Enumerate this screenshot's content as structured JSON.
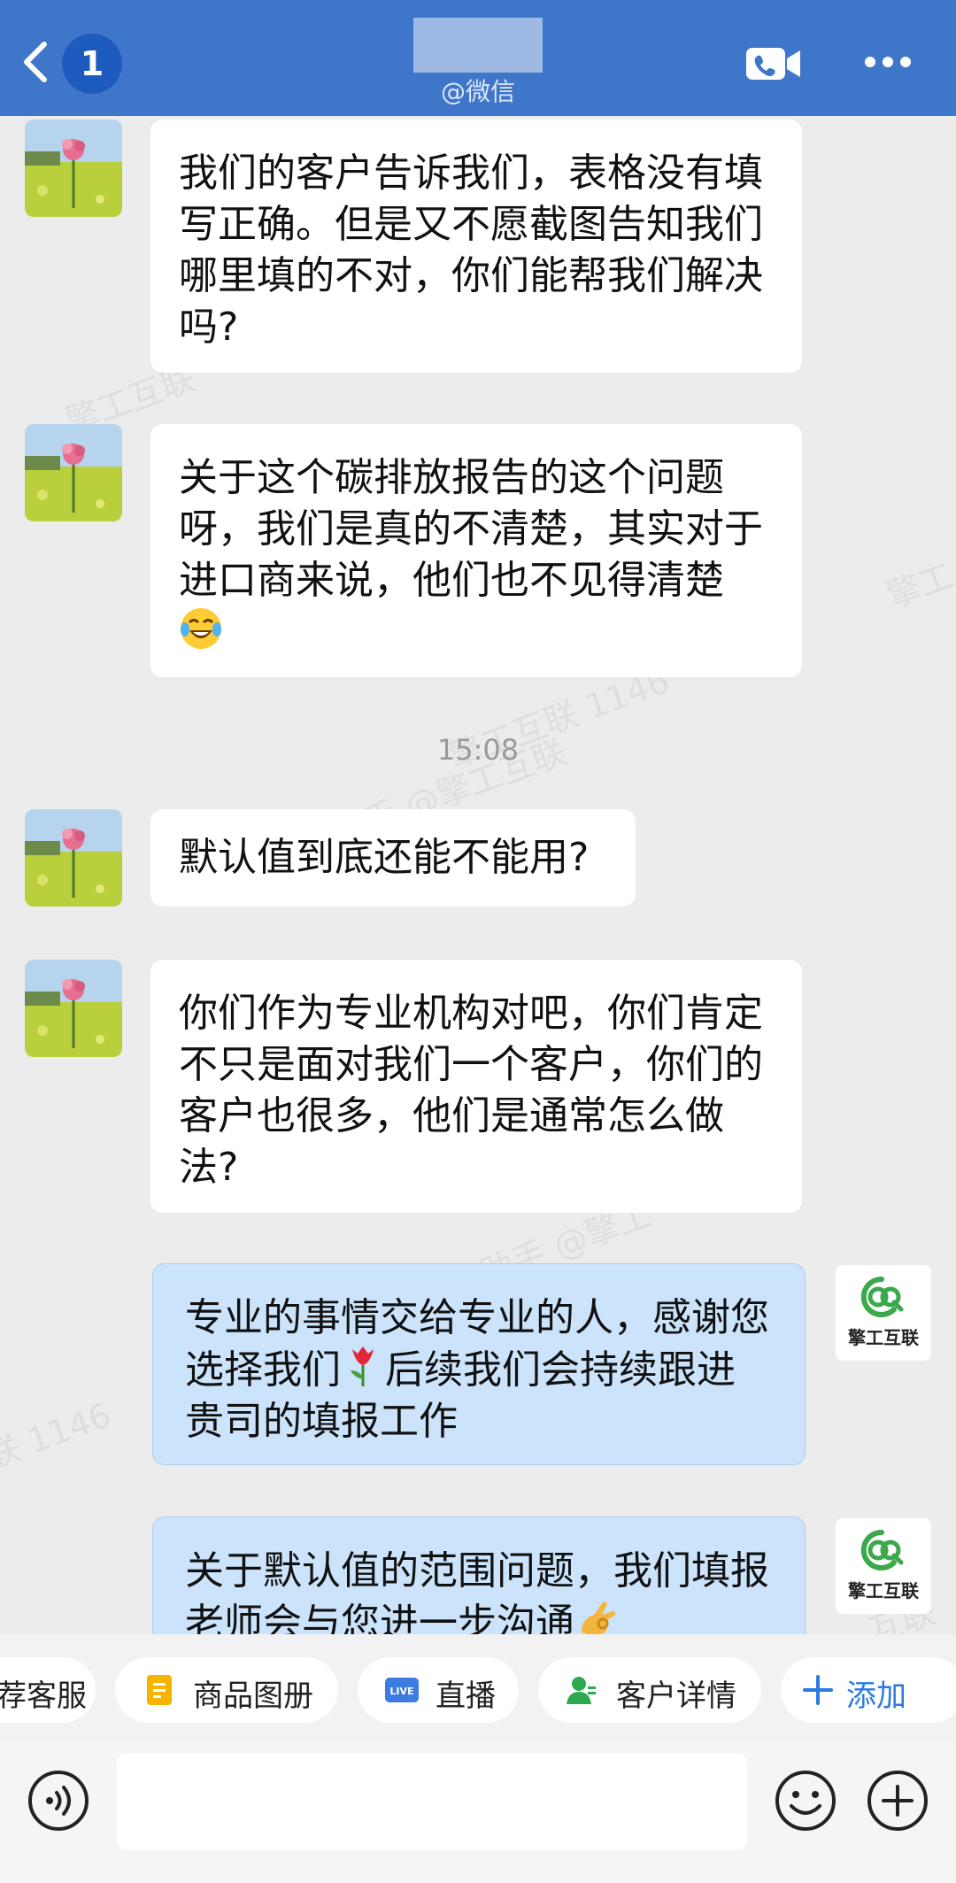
{
  "header": {
    "unread_count": "1",
    "subtitle": "@微信"
  },
  "messages": [
    {
      "side": "left",
      "text": "我们的客户告诉我们，表格没有填写正确。但是又不愿截图告知我们哪里填的不对，你们能帮我们解决吗?"
    },
    {
      "side": "left",
      "text": "关于这个碳排放报告的这个问题呀，我们是真的不清楚，其实对于进口商来说，他们也不见得清楚",
      "emoji": "tears-of-joy"
    },
    {
      "side": "left",
      "text": "默认值到底还能不能用?"
    },
    {
      "side": "left",
      "text": "你们作为专业机构对吧，你们肯定不只是面对我们一个客户，你们的客户也很多，他们是通常怎么做法?"
    },
    {
      "side": "right",
      "text_a": "专业的事情交给专业的人，感谢您选择我们",
      "emoji": "tulip",
      "text_b": "后续我们会持续跟进贵司的填报工作"
    },
    {
      "side": "right",
      "text": "关于默认值的范围问题，我们填报老师会与您进一步沟通",
      "emoji": "ok-hand"
    }
  ],
  "timestamp": "15:08",
  "agent_avatar": {
    "logo_text": "擎工互联"
  },
  "watermark": {
    "lines": [
      "擎工互联",
      "擎工互联 1146",
      "小助手 @擎工互联",
      "小助手 @擎工",
      "联 1146",
      "擎工",
      "互联"
    ]
  },
  "quick_actions": [
    "荐客服",
    "商品图册",
    "直播",
    "客户详情",
    "添加"
  ],
  "icons": {
    "live_badge": "LIVE"
  },
  "colors": {
    "header_bg": "#3f76c9",
    "chat_bg": "#ececec",
    "outgoing_bubble": "#cce4fb",
    "incoming_bubble": "#ffffff",
    "accent": "#2a7ae2",
    "brand_green": "#3aa84b"
  }
}
